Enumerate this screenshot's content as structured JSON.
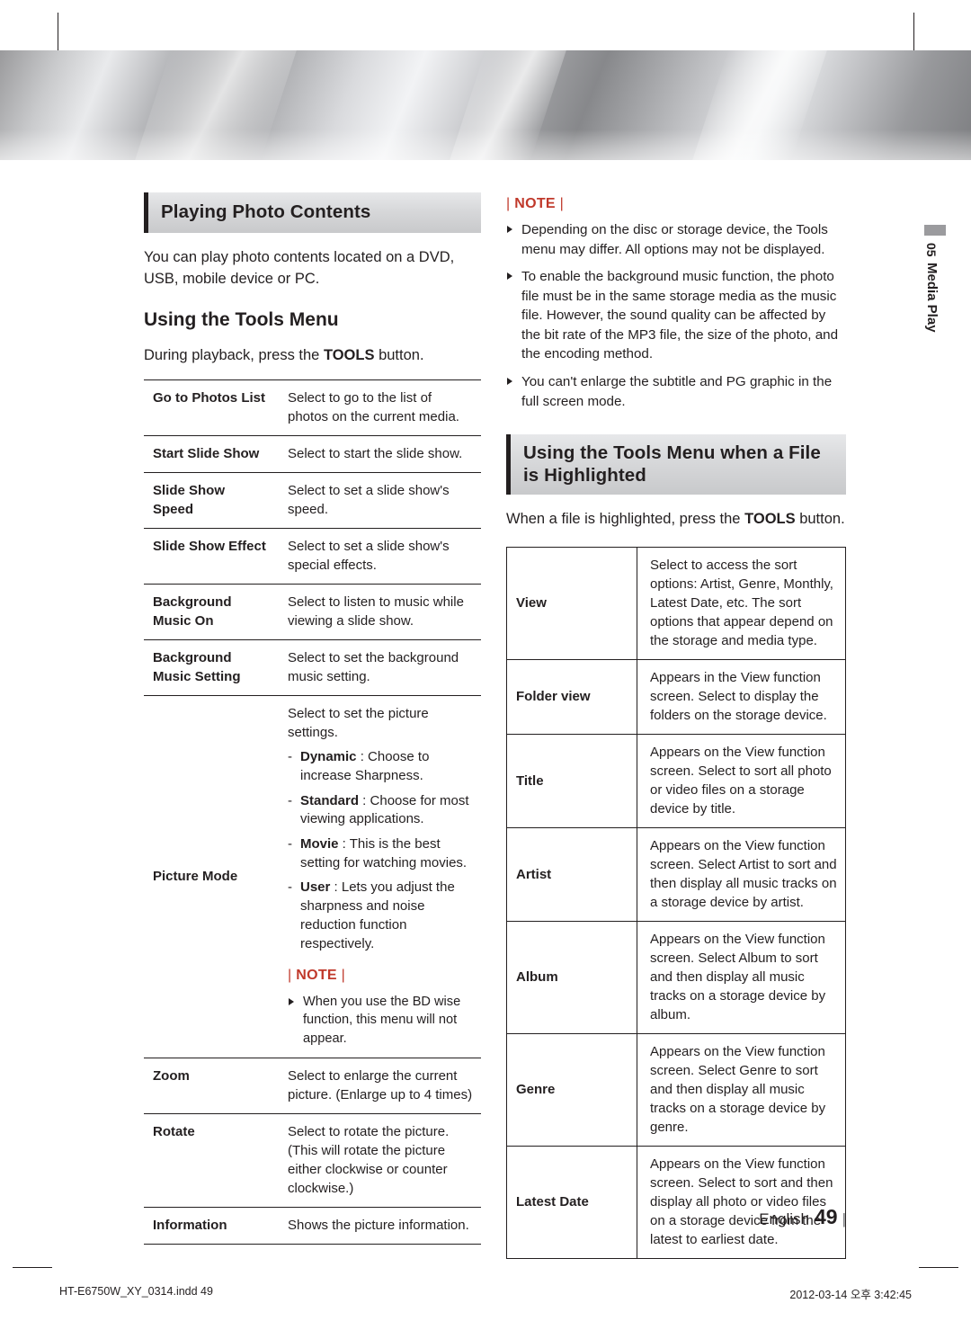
{
  "meta": {
    "page_number": "49",
    "page_language_label": "English",
    "footer_left": "HT-E6750W_XY_0314.indd   49",
    "footer_right": "2012-03-14   오후 3:42:45",
    "chapter_number": "05",
    "chapter_title": "Media Play"
  },
  "left": {
    "section_title": "Playing Photo Contents",
    "intro": "You can play photo contents located on a DVD, USB, mobile device or PC.",
    "sub_head": "Using the Tools Menu",
    "instruction_pre": "During playback, press the ",
    "instruction_key": "TOOLS",
    "instruction_post": " button.",
    "rows": [
      {
        "label": "Go to Photos List",
        "desc": "Select to go to the list of photos on the current media."
      },
      {
        "label": "Start Slide Show",
        "desc": "Select to start the slide show."
      },
      {
        "label": "Slide Show Speed",
        "desc": "Select to set a slide show's speed."
      },
      {
        "label": "Slide Show Effect",
        "desc": "Select to set a slide show's special effects."
      },
      {
        "label": "Background Music On",
        "desc": "Select to listen to music while viewing a slide show."
      },
      {
        "label": "Background Music Setting",
        "desc": "Select to set the background music setting."
      },
      {
        "label": "Zoom",
        "desc": "Select to enlarge the current picture. (Enlarge up to 4 times)"
      },
      {
        "label": "Rotate",
        "desc": "Select to rotate the picture. (This will rotate the picture either clockwise or counter clockwise.)"
      },
      {
        "label": "Information",
        "desc": "Shows the picture information."
      }
    ],
    "picture_mode": {
      "label": "Picture Mode",
      "lead": "Select to set the picture settings.",
      "options": [
        {
          "name": "Dynamic",
          "text": " : Choose to increase Sharpness."
        },
        {
          "name": "Standard",
          "text": " : Choose for most viewing applications."
        },
        {
          "name": "Movie",
          "text": " : This is the best setting for watching movies."
        },
        {
          "name": "User",
          "text": " : Lets you adjust the sharpness and noise reduction function respectively."
        }
      ],
      "note_label": "NOTE",
      "note_items": [
        "When you use the BD wise function, this menu will not appear."
      ]
    }
  },
  "right": {
    "note_label": "NOTE",
    "note_items": [
      "Depending on the disc or storage device, the Tools menu may differ. All options may not be displayed.",
      "To enable the background music function, the photo file must be in the same storage media as the music file. However, the sound quality can be affected by the bit rate of the MP3 file, the size of the photo, and the encoding method.",
      "You can't enlarge the subtitle and PG graphic in the full screen mode."
    ],
    "section_title_line1": "Using the Tools Menu when a File",
    "section_title_line2": "is Highlighted",
    "instruction_pre": "When a file is highlighted, press the ",
    "instruction_key": "TOOLS",
    "instruction_post": " button.",
    "rows": [
      {
        "label": "View",
        "desc": "Select to access the sort options: Artist, Genre, Monthly, Latest Date, etc. The sort options that appear depend on the storage and media type."
      },
      {
        "label": "Folder view",
        "desc": "Appears in the View function screen. Select to display the folders on the storage device."
      },
      {
        "label": "Title",
        "desc": "Appears on the View function screen. Select to sort all photo or video files on a storage device by title."
      },
      {
        "label": "Artist",
        "desc": "Appears on the View function screen. Select Artist to sort and then display all music tracks on a storage device by artist."
      },
      {
        "label": "Album",
        "desc": "Appears on the View function screen. Select Album to sort and then display all music tracks on a storage device by album."
      },
      {
        "label": "Genre",
        "desc": "Appears on the View function screen. Select Genre to sort and then display all music tracks on a storage device by genre."
      },
      {
        "label": "Latest Date",
        "desc": "Appears on the View function screen. Select to sort and then display all photo or video files on a storage device from the latest to earliest date."
      }
    ]
  },
  "colors": {
    "note_red": "#c0392b",
    "ink": "#231f20",
    "bar_gray": "#d5d6d8"
  }
}
